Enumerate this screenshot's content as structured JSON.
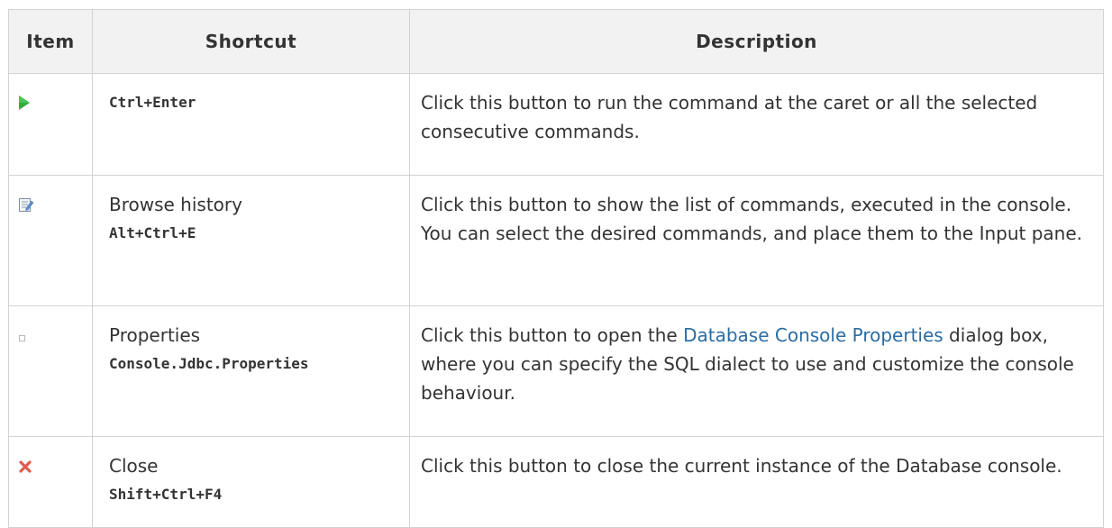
{
  "table": {
    "headers": {
      "item": "Item",
      "shortcut": "Shortcut",
      "description": "Description"
    },
    "rows": [
      {
        "icon": "run-icon",
        "name": "",
        "shortcut": "Ctrl+Enter",
        "description": "Click this button to run the command at the caret or all the selected consecutive commands."
      },
      {
        "icon": "history-icon",
        "name": "Browse history",
        "shortcut": "Alt+Ctrl+E",
        "description": "Click this button to show the list of commands, executed in the console. You can select the desired commands, and place them to the Input pane."
      },
      {
        "icon": "properties-icon",
        "name": "Properties",
        "shortcut": "Console.Jdbc.Properties",
        "description_before": "Click this button to open the ",
        "description_link": "Database Console Properties",
        "description_after": " dialog box, where you can specify the SQL dialect to use and customize the console behaviour."
      },
      {
        "icon": "close-icon",
        "name": "Close",
        "shortcut": "Shift+Ctrl+F4",
        "description": "Click this button to close the current instance of the Database console."
      }
    ]
  },
  "colors": {
    "header_bg": "#f2f2f2",
    "border": "#d3d3d3",
    "text": "#333333",
    "link": "#2b6ca3",
    "run_icon": "#2eae3a",
    "close_icon": "#e05b4e"
  }
}
